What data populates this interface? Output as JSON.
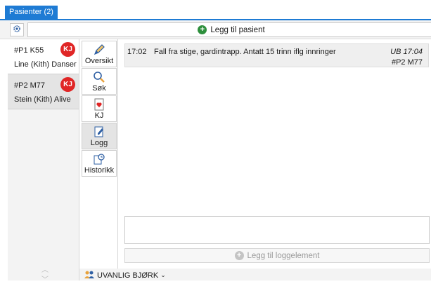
{
  "tabs": [
    {
      "label": "Pasienter (2)"
    }
  ],
  "toolbar": {
    "settings_icon": "gear-icon",
    "add_patient_label": "Legg til pasient",
    "add_icon": "plus-circle-icon",
    "accent": "#2d8f3c"
  },
  "patients": [
    {
      "id": "#P1 K55",
      "name": "Line (Kith) Danser",
      "badge": "KJ"
    },
    {
      "id": "#P2 M77",
      "name": "Stein (Kith) Alive",
      "badge": "KJ"
    }
  ],
  "nav": [
    {
      "label": "Oversikt",
      "icon": "pencil-icon"
    },
    {
      "label": "Søk",
      "icon": "magnifier-icon"
    },
    {
      "label": "KJ",
      "icon": "document-heart-icon"
    },
    {
      "label": "Logg",
      "icon": "clipboard-edit-icon"
    },
    {
      "label": "Historikk",
      "icon": "document-clock-icon"
    }
  ],
  "log": {
    "entries": [
      {
        "time": "17:02",
        "text": "Fall fra stige, gardintrapp. Antatt 15 trinn iflg innringer",
        "user": "UB 17:04",
        "patient": "#P2 M77"
      }
    ],
    "input_value": "",
    "add_label": "Legg til loggelement"
  },
  "footer": {
    "user_label": "UVANLIG BJØRK",
    "user_icon": "user-group-icon",
    "dropdown_icon": "chevron-down-icon"
  },
  "colors": {
    "tab_blue": "#1e7bd4",
    "badge_red": "#e02626"
  }
}
